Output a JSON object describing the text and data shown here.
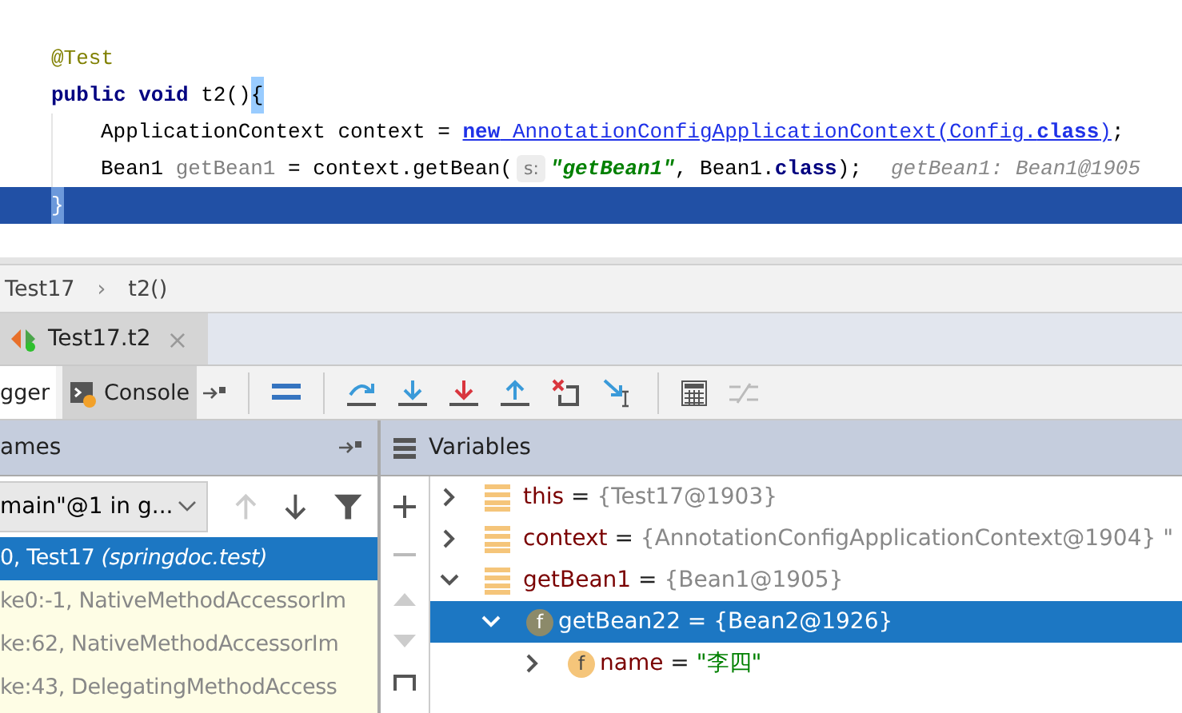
{
  "code": {
    "lines": [
      {
        "kind": "top",
        "selected": false,
        "tokens": [
          {
            "kind": "annotation",
            "text": "@Test"
          }
        ]
      },
      {
        "kind": "top",
        "selected": false,
        "tokens": [
          {
            "kind": "keyword",
            "text": "public void"
          },
          {
            "kind": "plain",
            "text": " t2()"
          },
          {
            "kind": "brace_match",
            "text": "{"
          }
        ]
      },
      {
        "kind": "body",
        "selected": false,
        "tokens": [
          {
            "kind": "plain",
            "text": "ApplicationContext context = "
          },
          {
            "kind": "link_keyword",
            "text": "new"
          },
          {
            "kind": "link",
            "text": " AnnotationConfigApplicationContext(Config."
          },
          {
            "kind": "link_keyword",
            "text": "class"
          },
          {
            "kind": "link",
            "text": ")"
          },
          {
            "kind": "plain",
            "text": ";"
          }
        ]
      },
      {
        "kind": "body",
        "selected": false,
        "tokens": [
          {
            "kind": "plain",
            "text": "Bean1 "
          },
          {
            "kind": "unused",
            "text": "getBean1"
          },
          {
            "kind": "plain",
            "text": " = context.getBean("
          },
          {
            "kind": "param_hint",
            "text": "s:"
          },
          {
            "kind": "string",
            "text": "\"getBean1\""
          },
          {
            "kind": "plain",
            "text": ", Bean1."
          },
          {
            "kind": "keyword",
            "text": "class"
          },
          {
            "kind": "plain",
            "text": ");"
          },
          {
            "kind": "inline_value",
            "text": "getBean1: Bean1@1905"
          }
        ]
      },
      {
        "kind": "top",
        "selected": true,
        "tokens": [
          {
            "kind": "brace_match",
            "text": "}"
          }
        ]
      }
    ]
  },
  "breadcrumb": [
    "Test17",
    "t2()"
  ],
  "separator": "›",
  "session_tab": {
    "label": "Test17.t2",
    "close": "×"
  },
  "tool_tabs": [
    {
      "label": "gger",
      "selected": true
    },
    {
      "label": "Console",
      "selected": false
    }
  ],
  "frames": {
    "title": "ames",
    "thread": "main\"@1 in g...",
    "items": [
      {
        "text": "0, Test17 *(springdoc.test)*",
        "selected": true
      },
      {
        "text": "ke0:-1, NativeMethodAccessorIm",
        "selected": false
      },
      {
        "text": "ke:62, NativeMethodAccessorIm",
        "selected": false
      },
      {
        "text": "ke:43, DelegatingMethodAccess",
        "selected": false
      }
    ]
  },
  "variables": {
    "title": "Variables",
    "assign": "=",
    "items": [
      {
        "kind": "local",
        "name": "this",
        "value": "{Test17@1903}",
        "color": "#888888",
        "expanded": false,
        "selected": false
      },
      {
        "kind": "local",
        "name": "context",
        "value": "{AnnotationConfigApplicationContext@1904} \"",
        "color": "#888888",
        "expanded": false,
        "selected": false
      },
      {
        "kind": "local",
        "name": "getBean1",
        "value": "{Bean1@1905}",
        "color": "#888888",
        "expanded": true,
        "selected": false,
        "children": [
          {
            "kind": "field",
            "icon_text": "f",
            "name": "getBean22",
            "value": "{Bean2@1926}",
            "color": "#ffffff",
            "expanded": true,
            "selected": true,
            "children": [
              {
                "kind": "field",
                "icon_text": "f",
                "name": "name",
                "value": "\"李四\"",
                "color": "#008000",
                "expanded": false,
                "selected": false
              }
            ]
          }
        ]
      }
    ]
  }
}
